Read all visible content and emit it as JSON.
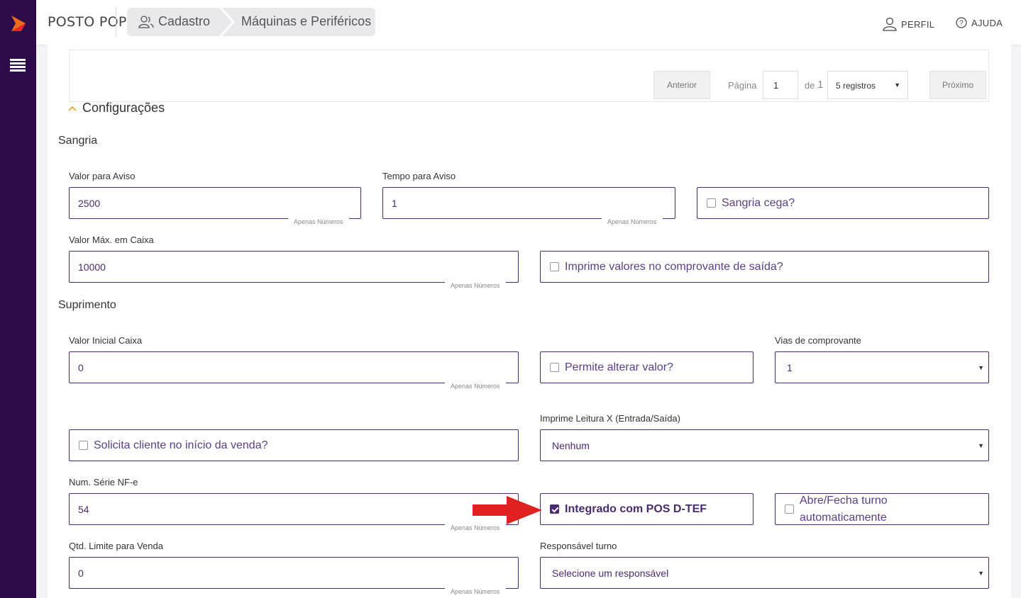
{
  "header": {
    "brand": "POSTO POP",
    "breadcrumb": [
      "Cadastro",
      "Máquinas e Periféricos"
    ],
    "profile": "PERFIL",
    "help": "AJUDA"
  },
  "pagination": {
    "prev": "Anterior",
    "page_label": "Página",
    "page": "1",
    "of_label": "de",
    "total_pages": "1",
    "per_page": "5 registros",
    "next": "Próximo"
  },
  "config_section": "Configurações",
  "sangria": {
    "title": "Sangria",
    "valor_aviso_label": "Valor para Aviso",
    "valor_aviso": "2500",
    "tempo_aviso_label": "Tempo para Aviso",
    "tempo_aviso": "1",
    "sangria_cega": "Sangria cega?",
    "valor_max_label": "Valor Máx. em Caixa",
    "valor_max": "10000",
    "imprime_valores": "Imprime valores no comprovante de saída?",
    "hint": "Apenas Números"
  },
  "suprimento": {
    "title": "Suprimento",
    "valor_inicial_label": "Valor Inicial Caixa",
    "valor_inicial": "0",
    "permite_alterar": "Permite alterar valor?",
    "vias_label": "Vias de comprovante",
    "vias": "1",
    "solicita_cliente": "Solicita cliente no início da venda?",
    "leitura_x_label": "Imprime Leitura X (Entrada/Saída)",
    "leitura_x": "Nenhum",
    "serie_label": "Num. Série NF-e",
    "serie": "54",
    "integrado_pos": "Integrado com POS D-TEF",
    "abre_fecha": "Abre/Fecha turno automaticamente",
    "qtd_limite_label": "Qtd. Limite para Venda",
    "qtd_limite": "0",
    "responsavel_label": "Responsável turno",
    "responsavel": "Selecione um responsável"
  },
  "colors": {
    "sidebar": "#2e0c4a",
    "accent": "#4a2b6e",
    "arrow": "#e02020",
    "logo": "#f06a1c"
  }
}
